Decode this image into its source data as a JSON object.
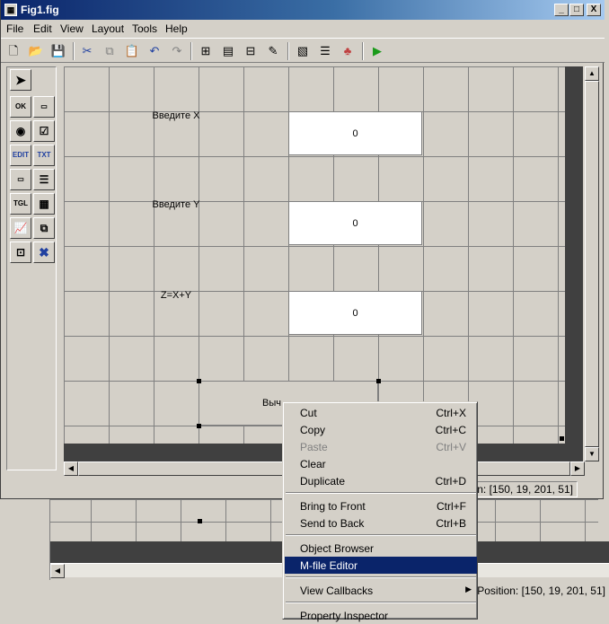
{
  "window": {
    "title": "Fig1.fig",
    "min": "_",
    "max": "□",
    "close": "X"
  },
  "menubar": [
    "File",
    "Edit",
    "View",
    "Layout",
    "Tools",
    "Help"
  ],
  "palette": {
    "items": [
      "select",
      "OK",
      "slider",
      "radio",
      "check",
      "EDIT",
      "TXT",
      "popup",
      "listbox",
      "TGL",
      "table",
      "axes",
      "panel",
      "buttongroup",
      "activex"
    ],
    "labels": {
      "ok": "OK",
      "edit": "EDIT",
      "txt": "TXT",
      "tgl": "TGL"
    }
  },
  "canvas": {
    "label_x": "Введите X",
    "edit_x": "0",
    "label_y": "Введите Y",
    "edit_y": "0",
    "label_z": "Z=X+Y",
    "edit_z": "0",
    "button": "Выч"
  },
  "status": "Position: [150, 19, 201, 51]",
  "status_visible": "n: [150, 19, 201, 51]",
  "bg_status": "Position: [150, 19, 201, 51]",
  "context_menu": {
    "items": [
      {
        "label": "Cut",
        "shortcut": "Ctrl+X"
      },
      {
        "label": "Copy",
        "shortcut": "Ctrl+C"
      },
      {
        "label": "Paste",
        "shortcut": "Ctrl+V"
      },
      {
        "label": "Clear",
        "shortcut": ""
      },
      {
        "label": "Duplicate",
        "shortcut": "Ctrl+D"
      },
      {
        "label": "Bring to Front",
        "shortcut": "Ctrl+F"
      },
      {
        "label": "Send to Back",
        "shortcut": "Ctrl+B"
      },
      {
        "label": "Object Browser",
        "shortcut": ""
      },
      {
        "label": "M-file Editor",
        "shortcut": ""
      },
      {
        "label": "View Callbacks",
        "shortcut": "▶"
      },
      {
        "label": "Property Inspector",
        "shortcut": ""
      }
    ]
  },
  "colors": {
    "selection": "#0a246a",
    "titlebar": "#0a246a",
    "run": "#1a9a1a"
  }
}
